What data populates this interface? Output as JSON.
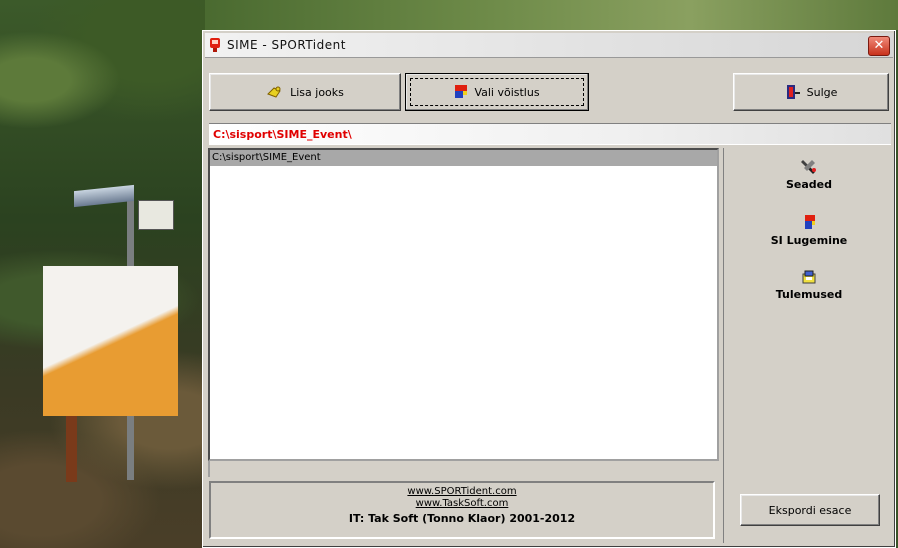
{
  "window": {
    "title": "SIME - SPORTident",
    "close_glyph": "✕"
  },
  "toolbar": {
    "add_run_label": "Lisa jooks",
    "select_start_label": "Vali võistlus",
    "close_label": "Sulge"
  },
  "path": {
    "current": "C:\\sisport\\SIME_Event\\"
  },
  "list": {
    "items": [
      "C:\\sisport\\SIME_Event"
    ]
  },
  "side": {
    "settings_label": "Seaded",
    "si_read_label": "SI Lugemine",
    "results_label": "Tulemused",
    "export_label": "Ekspordi esace"
  },
  "credits": {
    "link1": "www.SPORTident.com",
    "link2": "www.TaskSoft.com",
    "author": "IT: Tak Soft (Tonno Klaor) 2001-2012"
  },
  "colors": {
    "path_text": "#e00000",
    "window_bg": "#d4d0c8",
    "close_btn": "#c8321c"
  }
}
